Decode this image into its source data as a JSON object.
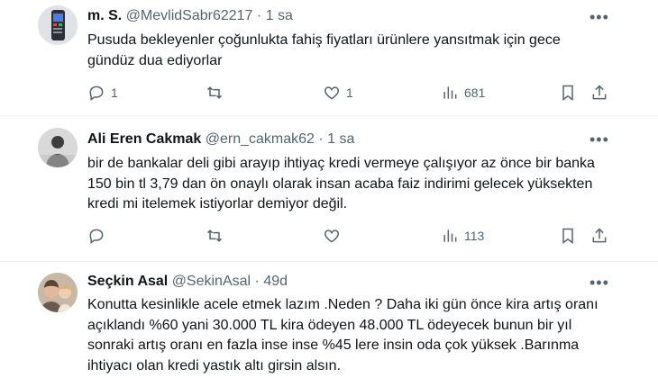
{
  "tweets": [
    {
      "name": "m. S.",
      "handle": "@MevlidSabr62217",
      "sep": "·",
      "time": "1 sa",
      "more": "•••",
      "text": "Pusuda bekleyenler çoğunlukta fahiş fiyatları ürünlere yansıtmak için gece gündüz dua ediyorlar",
      "replies": "1",
      "retweets": "",
      "likes": "1",
      "views": "681"
    },
    {
      "name": "Ali Eren Cakmak",
      "handle": "@ern_cakmak62",
      "sep": "·",
      "time": "1 sa",
      "more": "•••",
      "text": "bir de bankalar deli gibi arayıp ihtiyaç kredi vermeye çalışıyor az önce bir banka 150 bin tl 3,79 dan ön onaylı olarak insan acaba faiz indirimi gelecek yüksekten kredi mi itelemek istiyorlar demiyor değil.",
      "replies": "",
      "retweets": "",
      "likes": "",
      "views": "113"
    },
    {
      "name": "Seçkin Asal",
      "handle": "@SekinAsal",
      "sep": "·",
      "time": "49d",
      "more": "•••",
      "text": "Konutta kesinlikle acele etmek lazım .Neden ? Daha iki gün önce kira artış oranı açıklandı %60 yani 30.000 TL kira ödeyen 48.000 TL ödeyecek bunun bir yıl sonraki artış oranı en fazla inse inse %45 lere insin oda çok yüksek .Barınma ihtiyacı olan kredi yastık altı girsin alsın."
    }
  ]
}
